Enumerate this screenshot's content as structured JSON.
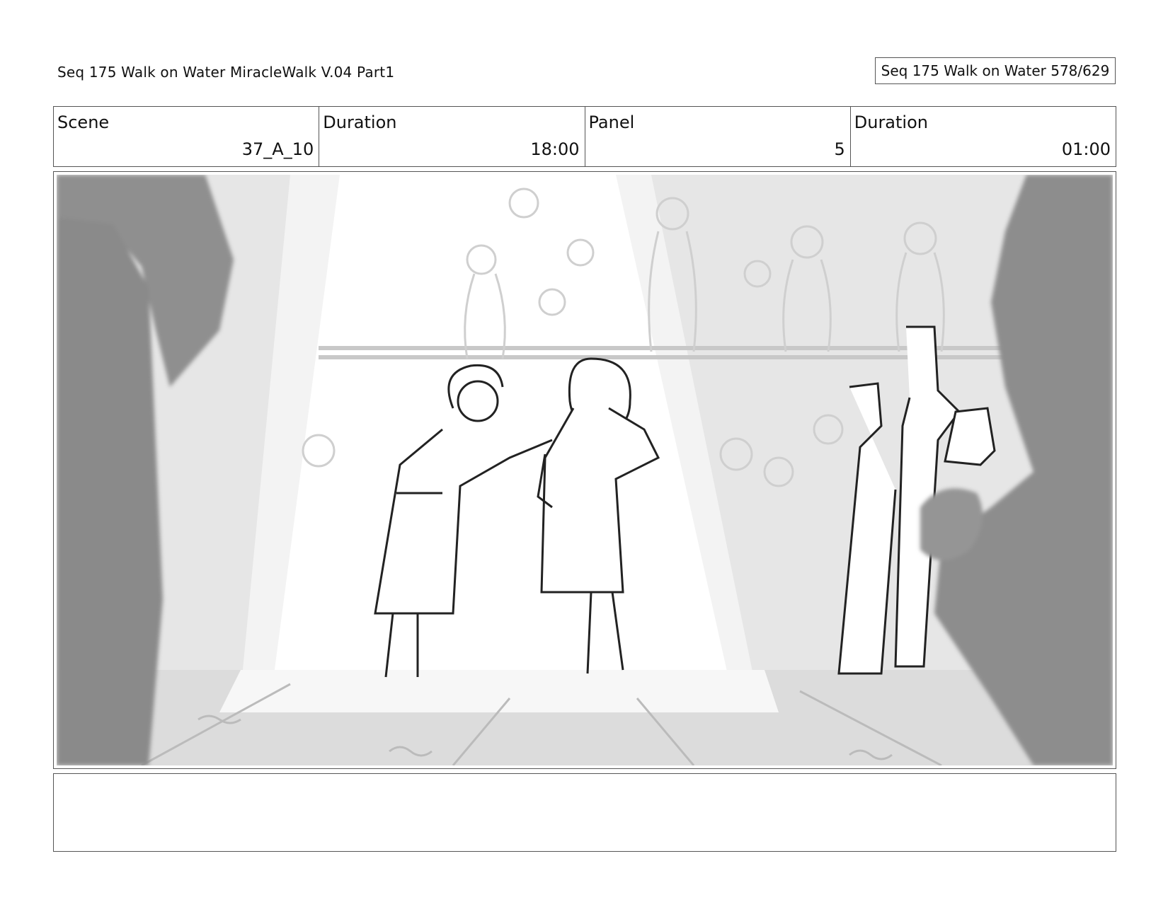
{
  "header": {
    "title": "Seq 175 Walk on Water  MiracleWalk V.04 Part1",
    "page_label": "Seq 175 Walk on Water 578/629"
  },
  "meta": {
    "scene_label": "Scene",
    "scene_value": "37_A_10",
    "duration_label": "Duration",
    "duration_value": "18:00",
    "panel_label": "Panel",
    "panel_value": "5",
    "panel_duration_label": "Duration",
    "panel_duration_value": "01:00"
  },
  "notes": {
    "text": ""
  }
}
